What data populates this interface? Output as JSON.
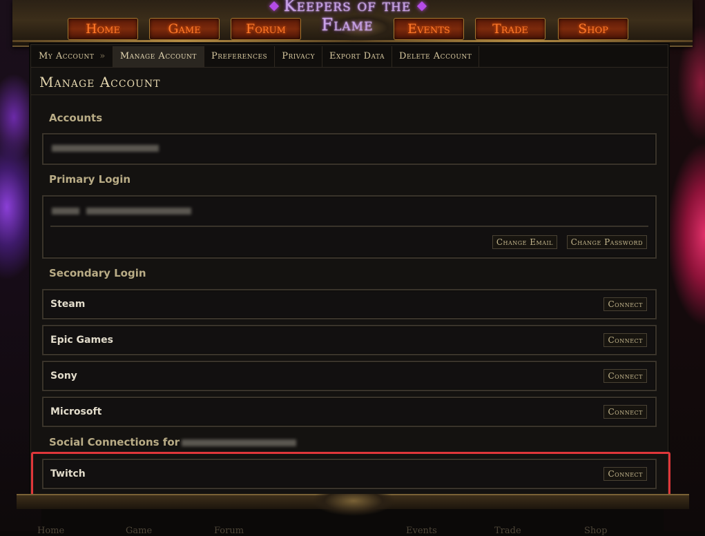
{
  "logo": "Keepers of the Flame",
  "nav": [
    {
      "label": "Home"
    },
    {
      "label": "Game"
    },
    {
      "label": "Forum"
    },
    {
      "label": "Events"
    },
    {
      "label": "Trade"
    },
    {
      "label": "Shop"
    }
  ],
  "breadcrumb": {
    "label": "My Account",
    "separator": "»"
  },
  "tabs": [
    {
      "label": "Manage Account"
    },
    {
      "label": "Preferences"
    },
    {
      "label": "Privacy"
    },
    {
      "label": "Export Data"
    },
    {
      "label": "Delete Account"
    }
  ],
  "page_title": "Manage Account",
  "sections": {
    "accounts_label": "Accounts",
    "primary_login_label": "Primary Login",
    "change_email": "Change Email",
    "change_password": "Change Password",
    "secondary_login_label": "Secondary Login",
    "social_label": "Social Connections for"
  },
  "secondary_logins": [
    {
      "name": "Steam",
      "button": "Connect"
    },
    {
      "name": "Epic Games",
      "button": "Connect"
    },
    {
      "name": "Sony",
      "button": "Connect"
    },
    {
      "name": "Microsoft",
      "button": "Connect"
    }
  ],
  "social": [
    {
      "name": "Twitch",
      "button": "Connect"
    }
  ],
  "footer": [
    "Home",
    "Game",
    "Forum",
    "Events",
    "Trade",
    "Shop"
  ]
}
